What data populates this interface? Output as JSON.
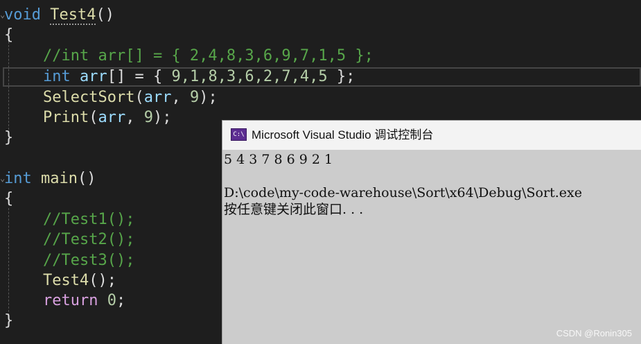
{
  "code": {
    "l1": {
      "kw": "void",
      "fn": "Test4",
      "rest": "()"
    },
    "l2": "{",
    "l3": "//int arr[] = { 2,4,8,3,6,9,7,1,5 };",
    "l4": {
      "kw": "int",
      "var": "arr",
      "rest": "[] = { ",
      "nums": "9,1,8,3,6,2,7,4,5",
      "end": " };"
    },
    "l5": {
      "fn": "SelectSort",
      "open": "(",
      "var": "arr",
      "sep": ", ",
      "num": "9",
      "end": ");"
    },
    "l6": {
      "fn": "Print",
      "open": "(",
      "var": "arr",
      "sep": ", ",
      "num": "9",
      "end": ");"
    },
    "l7": "}",
    "l9": {
      "kw": "int",
      "fn": "main",
      "rest": "()"
    },
    "l10": "{",
    "l11": "//Test1();",
    "l12": "//Test2();",
    "l13": "//Test3();",
    "l14": {
      "fn": "Test4",
      "end": "();"
    },
    "l15": {
      "kw": "return",
      "num": "0",
      "end": ";"
    },
    "l16": "}"
  },
  "console": {
    "icon_text": "C:\\",
    "title": "Microsoft Visual Studio 调试控制台",
    "output_line1": "5 4 3 7 8 6 9 2 1",
    "output_line3": "D:\\code\\my-code-warehouse\\Sort\\x64\\Debug\\Sort.exe",
    "output_line4": "按任意键关闭此窗口. . ."
  },
  "watermark": "CSDN @Ronin305",
  "colors": {
    "editor_bg": "#1e1e1e",
    "keyword": "#569cd6",
    "function": "#dcdcaa",
    "variable": "#9cdcfe",
    "number": "#b5cea8",
    "comment": "#57a64a",
    "control_keyword": "#d8a0df",
    "console_bg": "#cccccc",
    "console_icon": "#5c2d91"
  }
}
